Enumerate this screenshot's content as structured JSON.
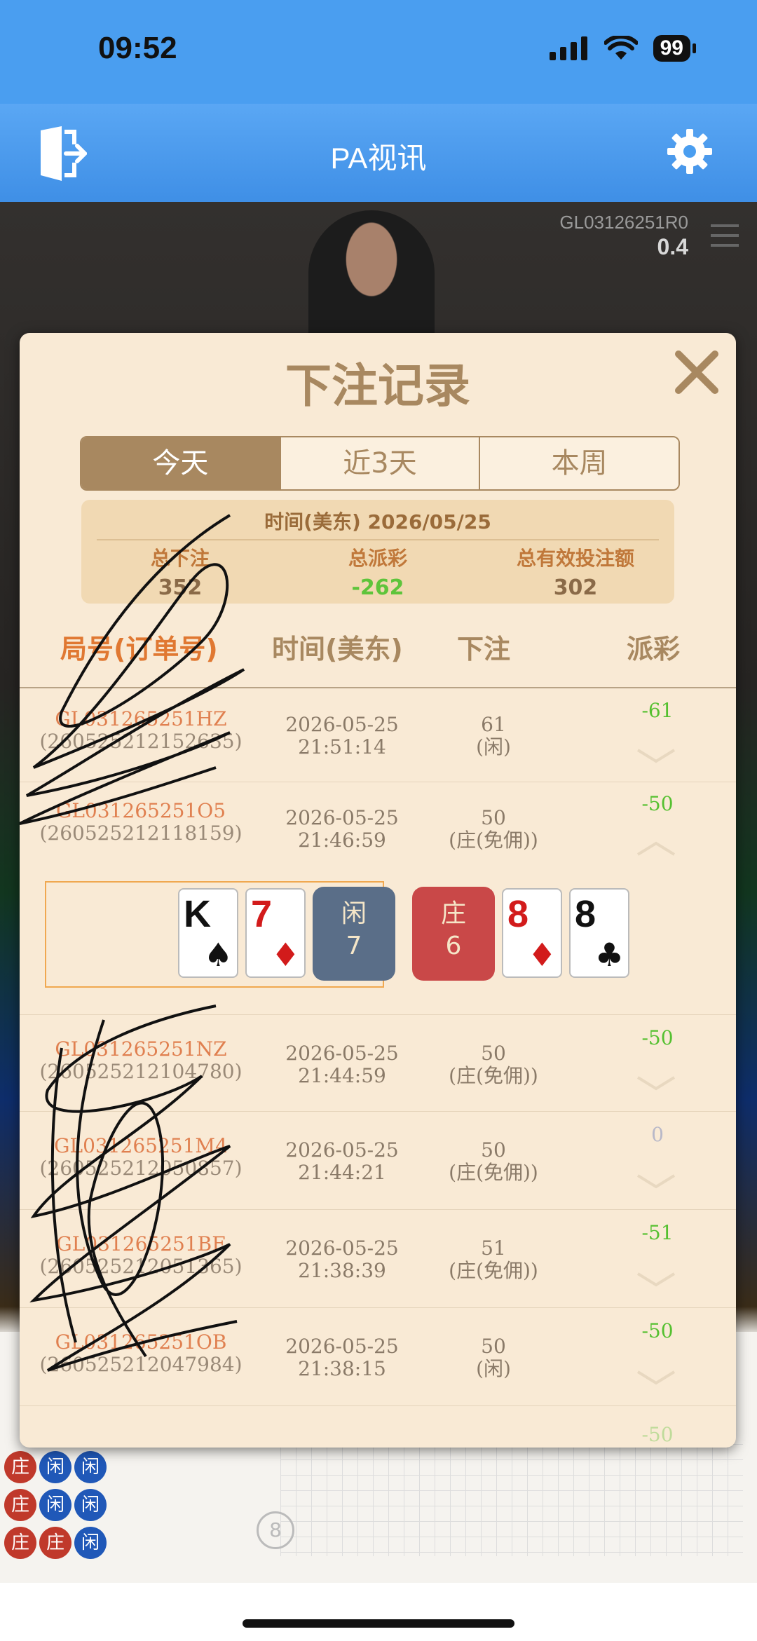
{
  "status_bar": {
    "time": "09:52",
    "battery": "99"
  },
  "app_bar": {
    "title": "PA视讯"
  },
  "video": {
    "round_code": "GL03126",
    "round_code_tail": "251R0",
    "value": "0.4"
  },
  "modal": {
    "title": "下注记录",
    "tabs": [
      {
        "label": "今天",
        "active": true
      },
      {
        "label": "近3天",
        "active": false
      },
      {
        "label": "本周",
        "active": false
      }
    ],
    "summary": {
      "time_label": "时间(美东)  2026/05/25",
      "total_bet_label": "总下注",
      "total_bet": "352",
      "total_payout_label": "总派彩",
      "total_payout": "-262",
      "valid_bet_label": "总有效投注额",
      "valid_bet": "302"
    },
    "columns": {
      "round": "局号(订单号)",
      "time": "时间(美东)",
      "bet": "下注",
      "payout": "派彩"
    },
    "rows": [
      {
        "round": "GL031265251HZ",
        "order": "(260525212152635)",
        "date": "2026-05-25",
        "time": "21:51:14",
        "bet": "61",
        "side": "(闲)",
        "payout": "-61"
      },
      {
        "round": "GL031265251O5",
        "order": "(260525212118159)",
        "date": "2026-05-25",
        "time": "21:46:59",
        "bet": "50",
        "side": "(庄(免佣))",
        "payout": "-50"
      },
      {
        "round": "GL031265251NZ",
        "order": "(260525212104780)",
        "date": "2026-05-25",
        "time": "21:44:59",
        "bet": "50",
        "side": "(庄(免佣))",
        "payout": "-50"
      },
      {
        "round": "GL031265251M4",
        "order": "(260525212050857)",
        "date": "2026-05-25",
        "time": "21:44:21",
        "bet": "50",
        "side": "(庄(免佣))",
        "payout": "0"
      },
      {
        "round": "GL031265251BF",
        "order": "(260525212051365)",
        "date": "2026-05-25",
        "time": "21:38:39",
        "bet": "51",
        "side": "(庄(免佣))",
        "payout": "-51"
      },
      {
        "round": "GL031265251OB",
        "order": "(260525212047984)",
        "date": "2026-05-25",
        "time": "21:38:15",
        "bet": "50",
        "side": "(闲)",
        "payout": "-50"
      }
    ],
    "detail": {
      "player_cards": [
        {
          "rank": "K",
          "suit": "♠",
          "color": "black"
        },
        {
          "rank": "7",
          "suit": "♦",
          "color": "red"
        }
      ],
      "player_label": "闲",
      "player_score": "7",
      "banker_label": "庄",
      "banker_score": "6",
      "banker_cards": [
        {
          "rank": "8",
          "suit": "♦",
          "color": "red"
        },
        {
          "rank": "8",
          "suit": "♣",
          "color": "black"
        }
      ]
    },
    "partial_next_payout": "-50"
  },
  "road": {
    "banker": "庄",
    "player": "闲",
    "counter": "8"
  },
  "colors": {
    "accent": "#a88860",
    "app_bar": "#4a9ef0",
    "modal_bg": "#f9ead5",
    "win_green": "#55c030"
  },
  "icons": [
    "exit-icon",
    "gear-icon",
    "close-icon",
    "chevron-down-icon",
    "chevron-up-icon",
    "signal-icon",
    "wifi-icon",
    "menu-icon"
  ]
}
